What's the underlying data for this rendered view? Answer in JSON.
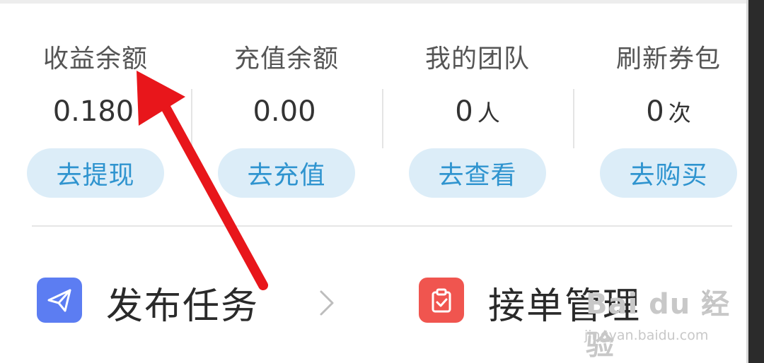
{
  "stats": [
    {
      "title": "收益余额",
      "value": "0.180",
      "unit": "",
      "action": "去提现"
    },
    {
      "title": "充值余额",
      "value": "0.00",
      "unit": "",
      "action": "去充值"
    },
    {
      "title": "我的团队",
      "value": "0",
      "unit": "人",
      "action": "去查看"
    },
    {
      "title": "刷新券包",
      "value": "0",
      "unit": "次",
      "action": "去购买"
    }
  ],
  "menu": [
    {
      "label": "发布任务",
      "icon": "paper-plane-icon",
      "color": "#5c7df2"
    },
    {
      "label": "接单管理",
      "icon": "clipboard-check-icon",
      "color": "#f0554f"
    }
  ],
  "colors": {
    "button_bg": "#dcedf8",
    "button_text": "#2f94cf",
    "annotation_arrow": "#e8161b"
  },
  "watermark": {
    "logo": "Bai du 经验",
    "url": "jingyan.baidu.com"
  }
}
